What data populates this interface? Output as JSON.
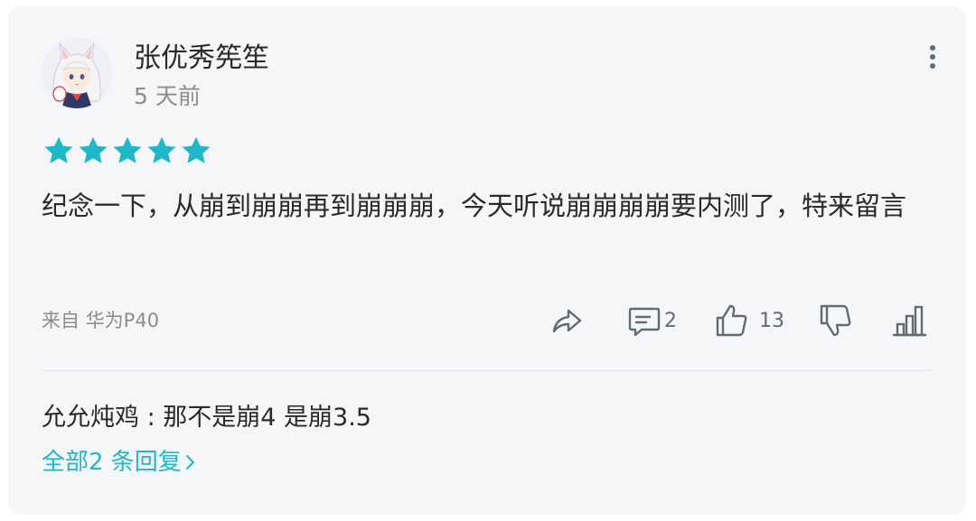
{
  "comment": {
    "username": "张优秀筅笙",
    "time": "5 天前",
    "rating": 5,
    "content": "纪念一下，从崩到崩崩再到崩崩崩，今天听说崩崩崩崩要内测了，特来留言",
    "device": "来自 华为P40",
    "actions": {
      "share_icon": "share-arrow-icon",
      "reply_icon": "comment-bubble-icon",
      "reply_count": "2",
      "like_icon": "thumbs-up-icon",
      "like_count": "13",
      "dislike_icon": "thumbs-down-icon",
      "more_icon": "vertical-dots-icon",
      "chart_icon": "bar-chart-icon"
    }
  },
  "replies": {
    "preview_author": "允允炖鸡",
    "preview_separator": " : ",
    "preview_text": "那不是崩4 是崩3.5",
    "view_all_label": "全部2 条回复"
  },
  "colors": {
    "accent": "#1fb8c9",
    "card_background": "#f5f6f8",
    "text_primary": "#2a2a2a",
    "text_secondary": "#8c8c8c"
  }
}
